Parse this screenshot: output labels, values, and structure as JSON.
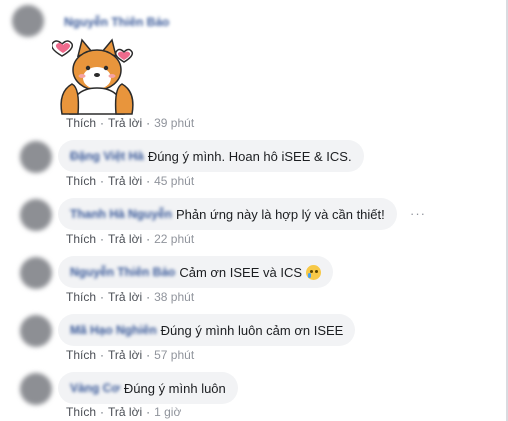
{
  "labels": {
    "like": "Thích",
    "reply": "Trả lời",
    "separator": "·",
    "more": "···"
  },
  "comments": [
    {
      "author": "Nguyễn Thiên Bảo",
      "text": "",
      "time": "39 phút",
      "sticker": "shiba-heart-sticker"
    },
    {
      "author": "Đặng Việt Hà",
      "text": "Đúng ý mình. Hoan hô iSEE & ICS.",
      "time": "45 phút"
    },
    {
      "author": "Thanh Hà Nguyễn",
      "text": "Phản ứng này là hợp lý và cần thiết!",
      "time": "22 phút"
    },
    {
      "author": "Nguyễn Thiên Bảo",
      "text": "Cảm ơn ISEE và ICS",
      "time": "38 phút",
      "emoji": "crying-face-icon"
    },
    {
      "author": "Mã Hạo Nghiên",
      "text": "Đúng ý mình luôn cảm ơn ISEE",
      "time": "57 phút"
    },
    {
      "author": "Vàng Cơ",
      "text": "Đúng ý mình luôn",
      "time": "1 giờ"
    }
  ],
  "colors": {
    "author": "#385898",
    "bubble": "#f2f3f5",
    "text": "#1c1e21",
    "meta": "#90949c"
  }
}
